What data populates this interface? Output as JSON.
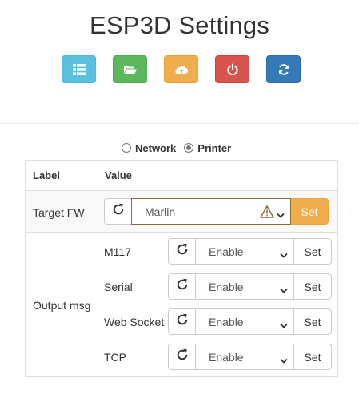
{
  "header": {
    "title": "ESP3D Settings"
  },
  "toolbar": {
    "buttons": [
      {
        "name": "list-button",
        "icon": "list-icon",
        "color": "#5bc0de"
      },
      {
        "name": "open-folder-button",
        "icon": "folder-open-icon",
        "color": "#5cb85c"
      },
      {
        "name": "cloud-upload-button",
        "icon": "cloud-upload-icon",
        "color": "#f0ad4e"
      },
      {
        "name": "power-button",
        "icon": "power-icon",
        "color": "#d9534f"
      },
      {
        "name": "refresh-button",
        "icon": "refresh-icon",
        "color": "#337ab7"
      }
    ]
  },
  "mode": {
    "options": [
      {
        "label": "Network",
        "checked": false
      },
      {
        "label": "Printer",
        "checked": true
      }
    ]
  },
  "table": {
    "headers": {
      "label": "Label",
      "value": "Value"
    },
    "target_fw": {
      "label": "Target FW",
      "value": "Marlin",
      "set_label": "Set"
    },
    "output_msg": {
      "label": "Output msg",
      "items": [
        {
          "label": "M117",
          "value": "Enable",
          "set_label": "Set"
        },
        {
          "label": "Serial",
          "value": "Enable",
          "set_label": "Set"
        },
        {
          "label": "Web Socket",
          "value": "Enable",
          "set_label": "Set"
        },
        {
          "label": "TCP",
          "value": "Enable",
          "set_label": "Set"
        }
      ]
    }
  }
}
